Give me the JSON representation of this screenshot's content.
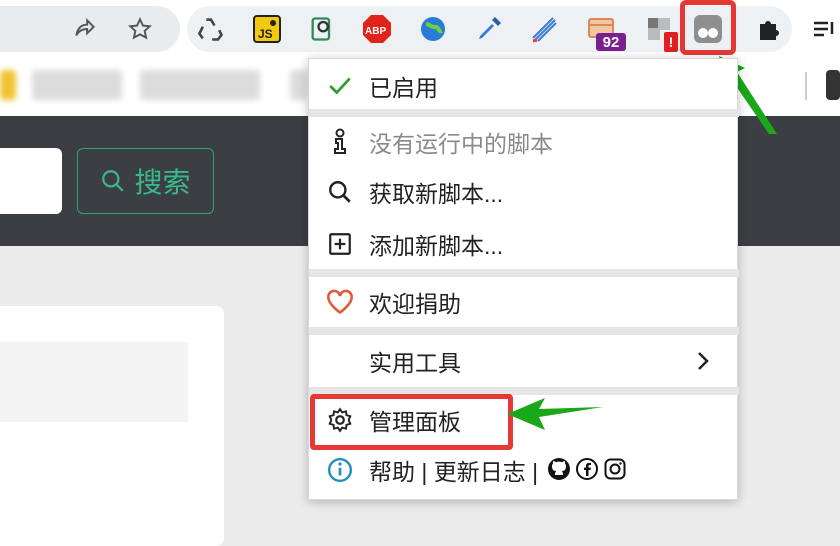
{
  "menu": {
    "enabled_label": "已启用",
    "no_scripts_label": "没有运行中的脚本",
    "get_scripts_label": "获取新脚本...",
    "add_script_label": "添加新脚本...",
    "donate_label": "欢迎捐助",
    "utilities_label": "实用工具",
    "dashboard_label": "管理面板",
    "help_label": "帮助 | 更新日志 |"
  },
  "page": {
    "search_button_label": "搜索"
  },
  "extensions": {
    "badge_count": "92",
    "badge_alert": "!"
  },
  "colors": {
    "highlight": "#e53935",
    "arrow": "#1aa81a",
    "check": "#2e9e2e",
    "heart": "#e05a3a",
    "search_accent": "#39b98a"
  }
}
